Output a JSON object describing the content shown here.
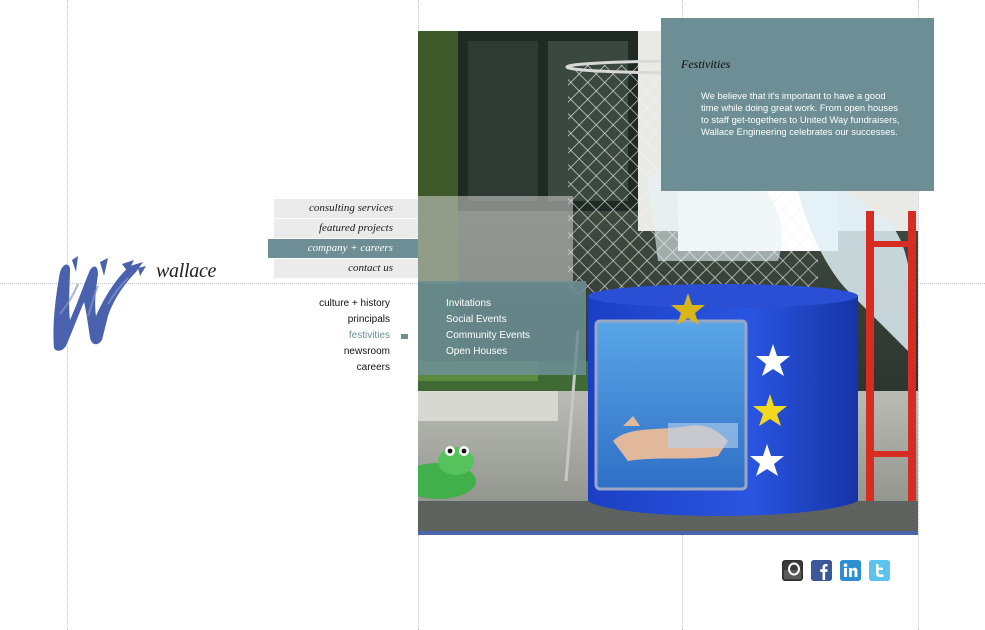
{
  "brand": {
    "name": "wallace",
    "logo_icon": "blue-brush-w-icon",
    "color": "#4a62ad"
  },
  "colors": {
    "accent": "#6c8e94",
    "nav_bg": "#ebebeb",
    "hero_bar": "#4a66a8"
  },
  "main_nav": [
    {
      "label": "consulting services",
      "active": false
    },
    {
      "label": "featured projects",
      "active": false
    },
    {
      "label": "company + careers",
      "active": true
    },
    {
      "label": "contact us",
      "active": false
    }
  ],
  "sub_nav": [
    {
      "label": "culture + history",
      "active": false
    },
    {
      "label": "principals",
      "active": false
    },
    {
      "label": "festivities",
      "active": true
    },
    {
      "label": "newsroom",
      "active": false
    },
    {
      "label": "careers",
      "active": false
    }
  ],
  "third_nav": [
    {
      "label": "Invitations"
    },
    {
      "label": "Social Events"
    },
    {
      "label": "Community Events"
    },
    {
      "label": "Open Houses"
    }
  ],
  "info_panel": {
    "title": "Festivities",
    "body": "We believe that it's important to have a good time while doing great work. From open houses to staff get-togethers to United Way fundraisers, Wallace Engineering celebrates our successes."
  },
  "hero_image": {
    "subject": "dunk tank at a company event"
  },
  "social": [
    {
      "icon": "outlook-icon"
    },
    {
      "icon": "facebook-icon"
    },
    {
      "icon": "linkedin-icon"
    },
    {
      "icon": "twitter-icon"
    }
  ]
}
